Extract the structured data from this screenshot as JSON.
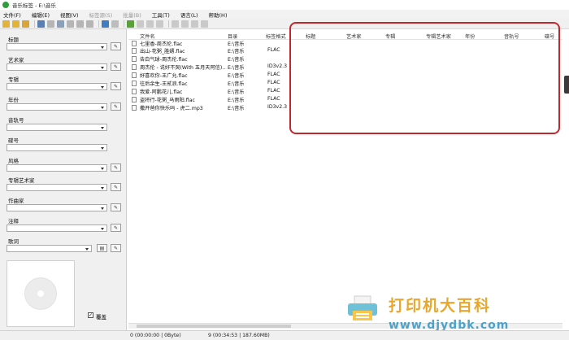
{
  "window": {
    "title": "音乐标签 - E:\\音乐"
  },
  "menu": [
    {
      "label": "文件(F)",
      "enabled": true
    },
    {
      "label": "编辑(E)",
      "enabled": true
    },
    {
      "label": "视图(V)",
      "enabled": true
    },
    {
      "label": "标签源(S)",
      "enabled": false
    },
    {
      "label": "批量(B)",
      "enabled": false
    },
    {
      "label": "工具(T)",
      "enabled": true
    },
    {
      "label": "语言(L)",
      "enabled": true
    },
    {
      "label": "帮助(H)",
      "enabled": true
    }
  ],
  "toolbar": {
    "buttons": [
      {
        "icon": "open-folder-icon",
        "color": "#e2b33b"
      },
      {
        "icon": "folder-icon",
        "color": "#e2b33b"
      },
      {
        "icon": "add-folder-icon",
        "color": "#d9a43a"
      },
      {
        "icon": "save-icon",
        "color": "#5b7fb0"
      },
      {
        "icon": "delete-icon",
        "color": "#b5b5b5"
      },
      {
        "icon": "undo-icon",
        "color": "#8aa0b8"
      },
      {
        "icon": "copy-icon",
        "color": "#b5b5b5"
      },
      {
        "icon": "paste-icon",
        "color": "#b5b5b5"
      },
      {
        "icon": "edit-icon",
        "color": "#b5b5b5"
      },
      {
        "icon": "grid-view-icon",
        "color": "#3f7dc0"
      },
      {
        "icon": "list-view-icon",
        "color": "#bdbdbd"
      },
      {
        "icon": "tag-source-icon",
        "color": "#5aa03b"
      },
      {
        "icon": "batch-icon",
        "color": "#c9c9c9"
      },
      {
        "icon": "rename-icon",
        "color": "#c9c9c9"
      },
      {
        "icon": "convert-icon",
        "color": "#c9c9c9"
      },
      {
        "icon": "cut-icon",
        "color": "#c9c9c9"
      },
      {
        "icon": "clipboard-icon",
        "color": "#c9c9c9"
      },
      {
        "icon": "audio-icon",
        "color": "#c9c9c9"
      },
      {
        "icon": "settings-icon",
        "color": "#c9c9c9"
      }
    ]
  },
  "fields": [
    {
      "label": "标题",
      "value": ""
    },
    {
      "label": "艺术家",
      "value": ""
    },
    {
      "label": "专辑",
      "value": ""
    },
    {
      "label": "年份",
      "value": ""
    },
    {
      "label": "音轨号",
      "value": ""
    },
    {
      "label": "碟号",
      "value": ""
    },
    {
      "label": "风格",
      "value": ""
    },
    {
      "label": "专辑艺术家",
      "value": ""
    },
    {
      "label": "作曲家",
      "value": ""
    },
    {
      "label": "注释",
      "value": ""
    },
    {
      "label": "歌词",
      "value": ""
    }
  ],
  "cover": {
    "checkbox_label": "覆盖",
    "checked": true
  },
  "columns": [
    "文件名",
    "目录",
    "标签格式",
    "标题",
    "艺术家",
    "专辑",
    "专辑艺术家",
    "年份",
    "音轨号",
    "碟号"
  ],
  "files": [
    {
      "name": "七里香-周杰伦.flac",
      "dir": "E:\\音乐",
      "format": ""
    },
    {
      "name": "出山-花粥_胜娚.flac",
      "dir": "E:\\音乐",
      "format": "FLAC"
    },
    {
      "name": "告白气球-周杰伦.flac",
      "dir": "E:\\音乐",
      "format": ""
    },
    {
      "name": "周杰伦 - 说好不哭(With 五月天阿信)...",
      "dir": "E:\\音乐",
      "format": "ID3v2.3"
    },
    {
      "name": "好喜欢你-王广允.flac",
      "dir": "E:\\音乐",
      "format": "FLAC"
    },
    {
      "name": "往后余生-王贰浪.flac",
      "dir": "E:\\音乐",
      "format": "FLAC"
    },
    {
      "name": "我爱-阿鹏花儿.flac",
      "dir": "E:\\音乐",
      "format": "FLAC"
    },
    {
      "name": "盗将行-花粥_马雨阳.flac",
      "dir": "E:\\音乐",
      "format": "FLAC"
    },
    {
      "name": "撒开爸你快乐吗 - 虎二.mp3",
      "dir": "E:\\音乐",
      "format": "ID3v2.3"
    }
  ],
  "status": {
    "selected": "0 (00:00:00 | 0Byte)",
    "total": "9 (00:34:53 | 187.60MB)"
  },
  "watermark": {
    "title": "打印机大百科",
    "url": "www.djydbk.com",
    "title_color": "#e8a72a",
    "url_color": "#4ba3c9"
  },
  "highlight_color": "#c0282e"
}
